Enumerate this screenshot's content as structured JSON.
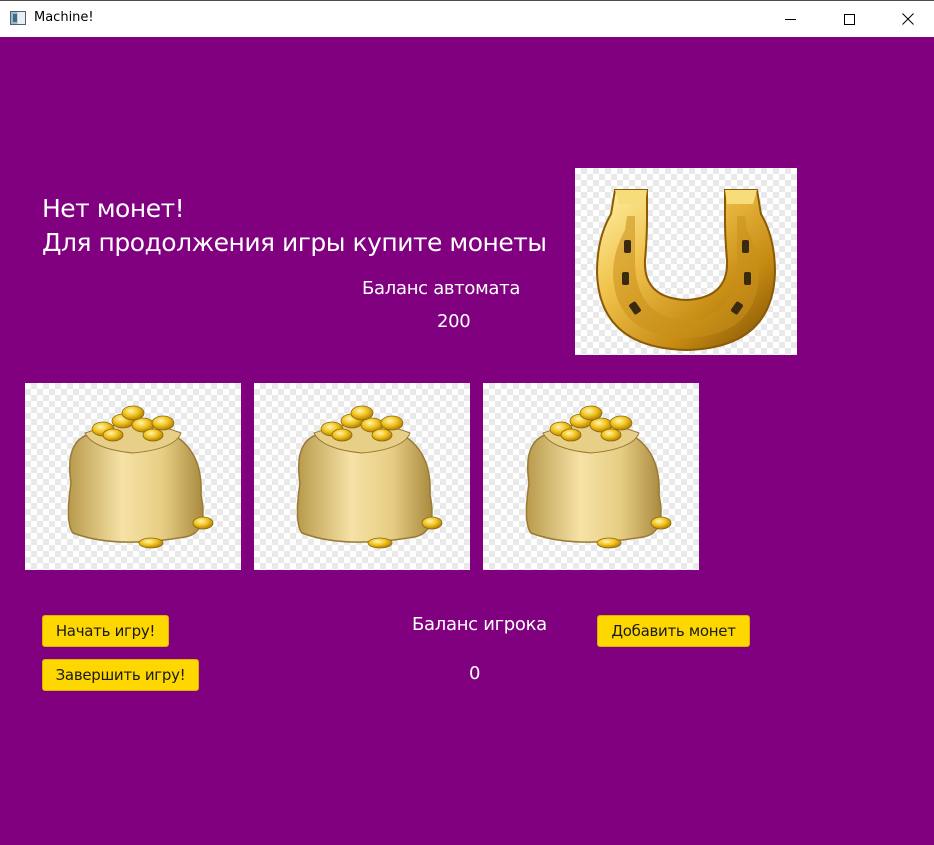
{
  "window": {
    "title": "Machine!"
  },
  "message": {
    "line1": "Нет монет!",
    "line2": "Для продолжения игры купите монеты"
  },
  "machine_balance": {
    "label": "Баланс автомата",
    "value": "200"
  },
  "player_balance": {
    "label": "Баланс игрока",
    "value": "0"
  },
  "buttons": {
    "start": "Начать игру!",
    "end": "Завершить игру!",
    "add_coins": "Добавить монет"
  },
  "images": {
    "logo": "horseshoe-icon",
    "reels": [
      "coin-bag-icon",
      "coin-bag-icon",
      "coin-bag-icon"
    ]
  },
  "colors": {
    "background": "#800080",
    "button": "#ffd700",
    "text": "#ffffff",
    "gold": "#d4a017"
  }
}
